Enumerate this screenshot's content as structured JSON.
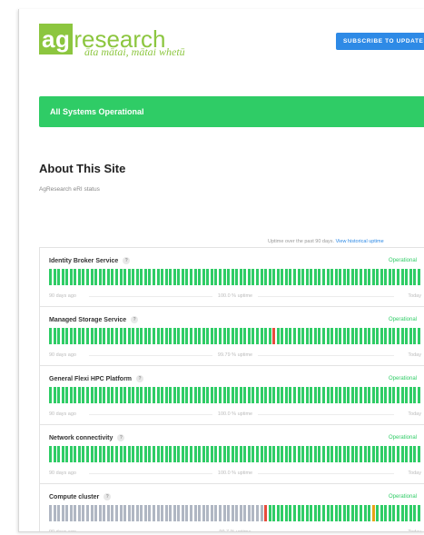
{
  "header": {
    "logo_prefix": "ag",
    "logo_suffix": "research",
    "tagline": "āta mātai, mātai whetū",
    "subscribe_label": "SUBSCRIBE TO UPDATES"
  },
  "status": {
    "banner_text": "All Systems Operational"
  },
  "about": {
    "title": "About This Site",
    "description": "AgResearch eRI status"
  },
  "uptime_note": {
    "text": "Uptime over the past 90 days.",
    "link": "View historical uptime"
  },
  "colors": {
    "brand_green": "#8cc63f",
    "operational": "#2fcc66",
    "outage": "#e74c3c",
    "partial": "#e8a317",
    "no_data": "#b0b7c3",
    "accent_blue": "#2e8ae6"
  },
  "components": [
    {
      "name": "Identity Broker Service",
      "status": "Operational",
      "left_label": "90 days ago",
      "uptime": "100.0 % uptime",
      "right_label": "Today",
      "days_no_data": 0,
      "outage_days": [],
      "partial_days": []
    },
    {
      "name": "Managed Storage Service",
      "status": "Operational",
      "left_label": "90 days ago",
      "uptime": "99.79 % uptime",
      "right_label": "Today",
      "days_no_data": 0,
      "outage_days": [
        54
      ],
      "partial_days": []
    },
    {
      "name": "General Flexi HPC Platform",
      "status": "Operational",
      "left_label": "90 days ago",
      "uptime": "100.0 % uptime",
      "right_label": "Today",
      "days_no_data": 0,
      "outage_days": [],
      "partial_days": []
    },
    {
      "name": "Network connectivity",
      "status": "Operational",
      "left_label": "90 days ago",
      "uptime": "100.0 % uptime",
      "right_label": "Today",
      "days_no_data": 0,
      "outage_days": [],
      "partial_days": []
    },
    {
      "name": "Compute cluster",
      "status": "Operational",
      "left_label": "90 days ago",
      "uptime": "99.7 % uptime",
      "right_label": "Today",
      "days_no_data": 52,
      "outage_days": [
        52
      ],
      "partial_days": [
        78
      ]
    }
  ]
}
